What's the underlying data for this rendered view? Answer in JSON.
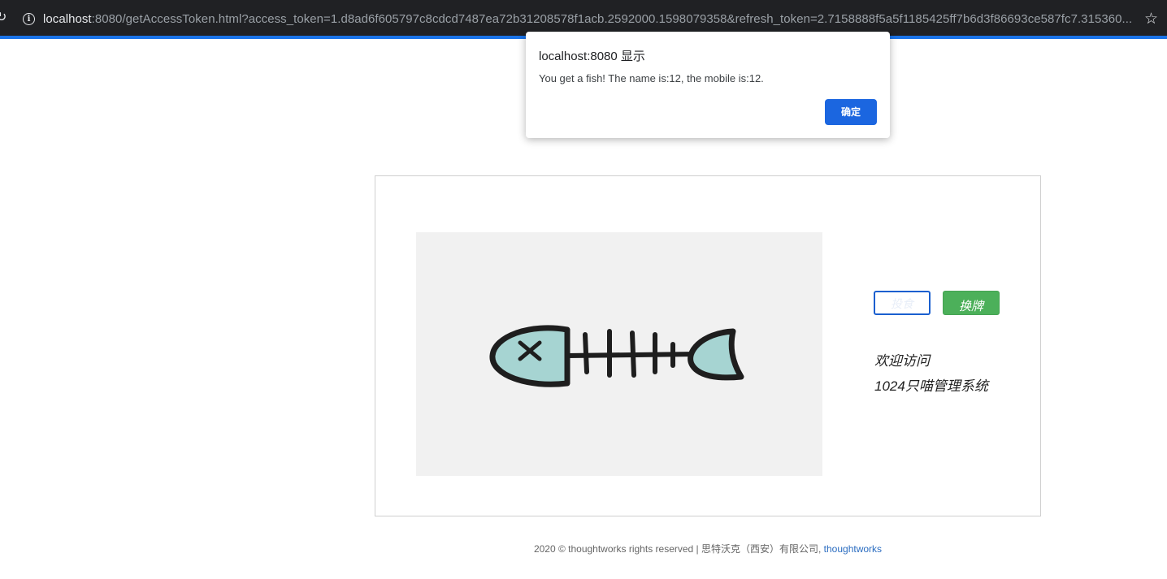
{
  "browser": {
    "reload_glyph": "↻",
    "url_host": "localhost",
    "url_rest": ":8080/getAccessToken.html?access_token=1.d8ad6f605797c8cdcd7487ea72b31208578f1acb.2592000.1598079358&refresh_token=2.7158888f5a5f1185425ff7b6d3f86693ce587fc7.315360...",
    "icons": [
      "info-icon",
      "star-icon"
    ]
  },
  "dialog": {
    "title": "localhost:8080 显示",
    "message": "You get a fish! The name is:12, the mobile is:12.",
    "ok_label": "确定"
  },
  "main": {
    "outline_button_label": "投食",
    "green_button_label": "换牌",
    "welcome_line1": "欢迎访问",
    "welcome_line2": "1024只喵管理系统"
  },
  "footer": {
    "text": "2020 © thoughtworks rights reserved | 思特沃克（西安）有限公司, ",
    "link_label": "thoughtworks"
  },
  "colors": {
    "accent_blue": "#1a73e8",
    "green_button": "#4cb05a",
    "fish_fill": "#a6d4d2"
  }
}
